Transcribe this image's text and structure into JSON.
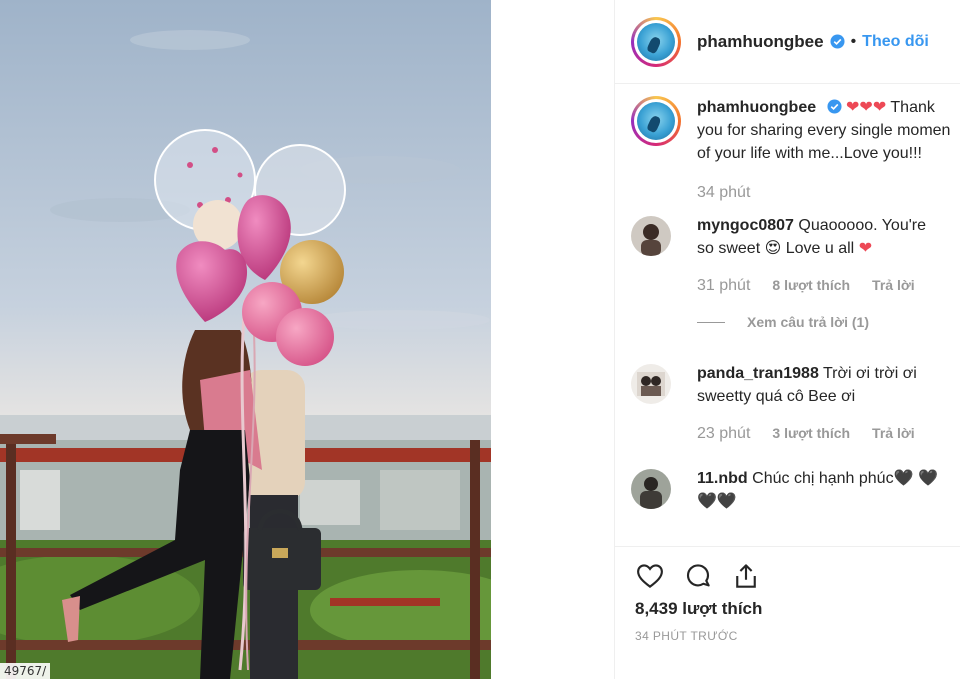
{
  "photo": {
    "caption": "49767/"
  },
  "post": {
    "username": "phamhuongbee",
    "follow_label": "Theo dõi",
    "separator": "•",
    "caption_text": "❤️❤️❤️ Thank you for sharing every single moment of your life with me...Love you!!!",
    "caption_line1": "Thank",
    "caption_line2": "you for sharing every single momen",
    "caption_line3": "of your life with me...Love you!!!",
    "caption_time": "34 phút"
  },
  "comments": [
    {
      "username": "myngoc0807",
      "line1": "Quaooooo. You're",
      "line2_a": "so sweet",
      "line2_b": "Love u all",
      "time": "31 phút",
      "likes": "8 lượt thích",
      "reply": "Trả lời",
      "view_replies": "Xem câu trả lời (1)"
    },
    {
      "username": "panda_tran1988",
      "line1": "Trời ơi trời ơi",
      "line2": "sweetty quá cô Bee ơi",
      "time": "23 phút",
      "likes": "3 lượt thích",
      "reply": "Trả lời"
    },
    {
      "username": "11.nbd",
      "line1": "Chúc chị hạnh phúc",
      "line2": ""
    }
  ],
  "footer": {
    "likes": "8,439 lượt thích",
    "timestamp": "34 PHÚT TRƯỚC"
  },
  "icons": {
    "like": "heart-outline-icon",
    "comment": "comment-bubble-icon",
    "share": "share-upload-icon",
    "verified": "verified-badge-icon"
  },
  "colors": {
    "link_blue": "#3897f0",
    "heart_red": "#ed4956",
    "muted": "#999999",
    "text": "#262626"
  }
}
